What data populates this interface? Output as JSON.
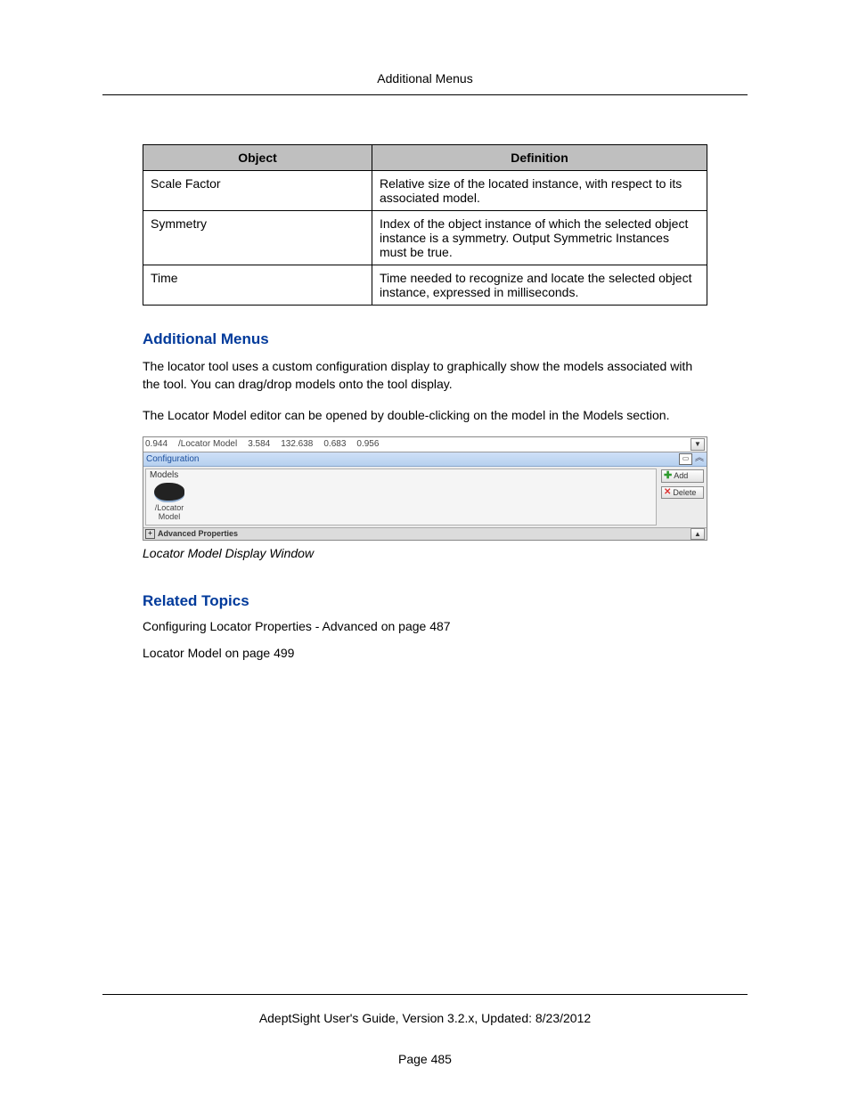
{
  "header": {
    "running_title": "Additional Menus"
  },
  "table": {
    "headers": {
      "object": "Object",
      "definition": "Definition"
    },
    "rows": [
      {
        "object": "Scale Factor",
        "definition": "Relative size of the located instance, with respect to its associated model."
      },
      {
        "object": "Symmetry",
        "definition": "Index of the object instance of which the selected object instance is a symmetry. Output Symmetric Instances must be true."
      },
      {
        "object": "Time",
        "definition": "Time needed to recognize and locate the selected object instance, expressed in milliseconds."
      }
    ]
  },
  "sections": {
    "additional_menus": {
      "title": "Additional Menus",
      "p1": "The locator tool uses a custom configuration display to graphically show the models associated with the tool. You can drag/drop models onto the tool display.",
      "p2": "The Locator Model editor can be opened by double-clicking on the model in the Models section."
    },
    "related": {
      "title": "Related Topics",
      "links": [
        "Configuring Locator Properties - Advanced on page 487",
        "Locator Model on page 499"
      ]
    }
  },
  "figure": {
    "row1": [
      "0.944",
      "/Locator Model",
      "3.584",
      "132.638",
      "0.683",
      "0.956"
    ],
    "config_label": "Configuration",
    "models_group": "Models",
    "model_item": "/Locator Model",
    "add_btn": "Add",
    "delete_btn": "Delete",
    "advanced": "Advanced Properties",
    "caption": "Locator Model Display Window"
  },
  "footer": {
    "guide": "AdeptSight User's Guide,  Version 3.2.x, Updated: 8/23/2012",
    "page": "Page 485"
  }
}
